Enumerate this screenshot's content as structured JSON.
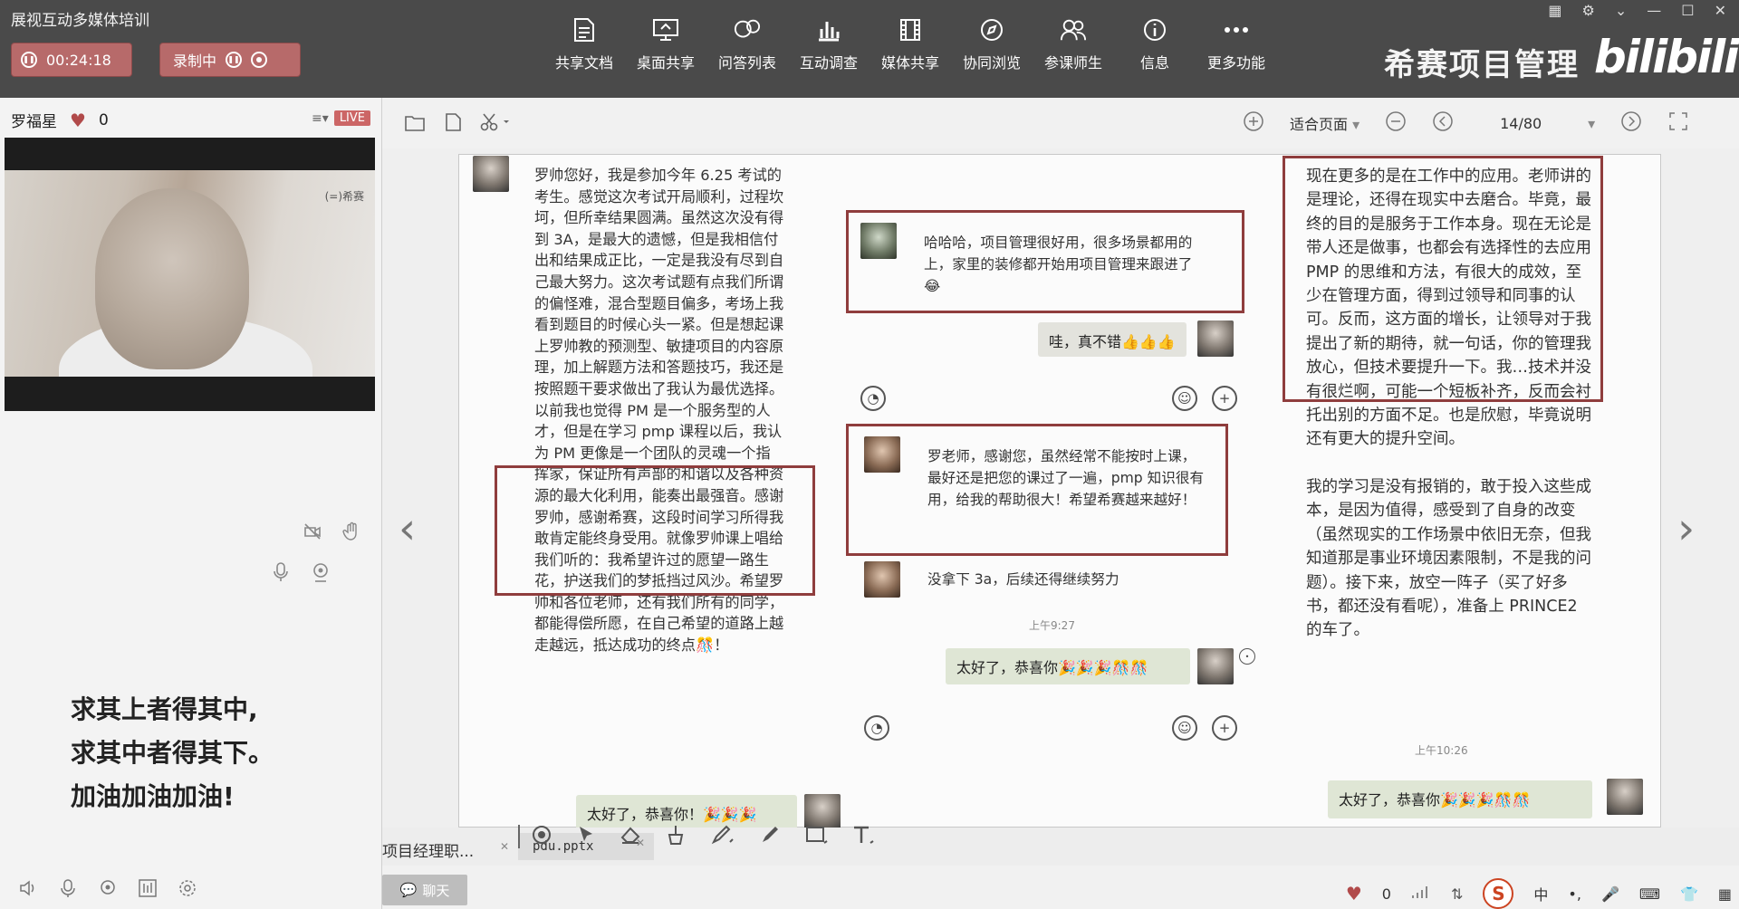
{
  "app": {
    "title": "展视互动多媒体培训",
    "timer": "00:24:18",
    "recording_label": "录制中",
    "brand_text": "希赛项目管理",
    "brand_logo": "bilibili"
  },
  "toolbar": [
    {
      "label": "共享文档",
      "icon": "document-icon"
    },
    {
      "label": "桌面共享",
      "icon": "desktop-share-icon"
    },
    {
      "label": "问答列表",
      "icon": "qa-list-icon"
    },
    {
      "label": "互动调查",
      "icon": "survey-chart-icon"
    },
    {
      "label": "媒体共享",
      "icon": "media-film-icon"
    },
    {
      "label": "协同浏览",
      "icon": "compass-icon"
    },
    {
      "label": "参课师生",
      "icon": "users-icon"
    },
    {
      "label": "信息",
      "icon": "info-icon"
    },
    {
      "label": "更多功能",
      "icon": "more-icon"
    }
  ],
  "presenter": {
    "name": "罗福星",
    "likes": "0",
    "live_badge": "LIVE",
    "video_watermark": "(=)希赛"
  },
  "motto": [
    "求其上者得其中,",
    "求其中者得其下。",
    "加油加油加油!"
  ],
  "document": {
    "zoom_label": "适合页面",
    "page": "14/80"
  },
  "slide": {
    "col1_text": "罗帅您好，我是参加今年 6.25 考试的考生。感觉这次考试开局顺利，过程坎坷，但所幸结果圆满。虽然这次没有得到 3A，是最大的遗憾，但是我相信付出和结果成正比，一定是我没有尽到自己最大努力。这次考试题有点我们所谓的偏怪难，混合型题目偏多，考场上我看到题目的时候心头一紧。但是想起课上罗帅教的预测型、敏捷项目的内容原理，加上解题方法和答题技巧，我还是按照题干要求做出了我认为最优选择。以前我也觉得 PM 是一个服务型的人才，但是在学习 pmp 课程以后，我认为 PM 更像是一个团队的灵魂一个指挥家，保证所有声部的和谐以及各种资源的最大化利用，能奏出最强音。感谢罗帅，感谢希赛，这段时间学习所得我敢肯定能终身受用。就像罗帅课上唱给我们听的：我希望许过的愿望一路生花，护送我们的梦抵挡过风沙。希望罗帅和各位老师，还有我们所有的同学，都能得偿所愿，在自己希望的道路上越走越远，抵达成功的终点🎊！",
    "col1_reply": "太好了，恭喜你！🎉🎉🎉",
    "msg1": "哈哈哈，项目管理很好用，很多场景都用的上，家里的装修都开始用项目管理来跟进了😂",
    "msg1_reply": "哇，真不错👍👍👍",
    "msg2": "罗老师，感谢您，虽然经常不能按时上课，最好还是把您的课过了一遍，pmp 知识很有用，给我的帮助很大！希望希赛越来越好！",
    "msg3": "没拿下 3a，后续还得继续努力",
    "time1": "上午9:27",
    "msg3_reply": "太好了，恭喜你🎉🎉🎉🎊🎊",
    "col3_p1": "现在更多的是在工作中的应用。老师讲的是理论，还得在现实中去磨合。毕竟，最终的目的是服务于工作本身。现在无论是带人还是做事，也都会有选择性的去应用 PMP 的思维和方法，有很大的成效，至少在管理方面，得到过领导和同事的认可。反而，这方面的增长，让领导对于我提出了新的期待，就一句话，你的管理我放心，但技术要提升一下。我…技术并没有很烂啊，可能一个短板补齐，反而会衬托出别的方面不足。也是欣慰，毕竟说明还有更大的提升空间。",
    "col3_p2": "我的学习是没有报销的，敢于投入这些成本，是因为值得，感受到了自身的改变（虽然现实的工作场景中依旧无奈，但我知道那是事业环境因素限制，不是我的问题）。接下来，放空一阵子（买了好多书，都还没有看呢），准备上 PRINCE2 的车了。",
    "time2": "上午10:26",
    "col3_reply": "太好了，恭喜你🎉🎉🎉🎊🎊"
  },
  "tabs": [
    {
      "label": "项目经理职..."
    },
    {
      "label": "pdu.pptx"
    }
  ],
  "chat": {
    "button_label": "聊天",
    "likes": "0",
    "ime_label": "中"
  },
  "colors": {
    "topbar": "#4a4a4a",
    "accent_red": "#b76a6a",
    "highlight_box": "#8f3d3d"
  }
}
